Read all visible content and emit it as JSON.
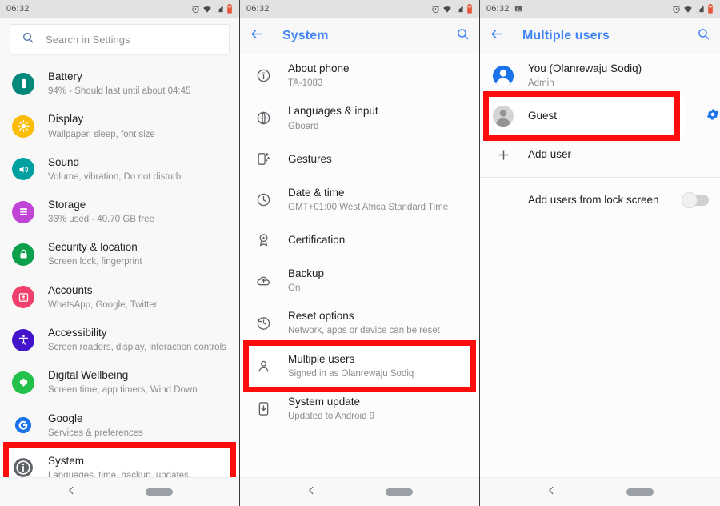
{
  "statusbar": {
    "time": "06:32",
    "icons_right": [
      "alarm-icon",
      "wifi-icon",
      "signal-icon",
      "battery-icon"
    ],
    "panel3_left_icon": "screenshot-icon"
  },
  "panel1": {
    "name": "settings-home",
    "search": {
      "placeholder": "Search in Settings",
      "icon": "search-icon"
    },
    "items": [
      {
        "title": "Battery",
        "subtitle": "94% - Should last until about 04:45",
        "icon": "battery-icon",
        "color": "#00897b"
      },
      {
        "title": "Display",
        "subtitle": "Wallpaper, sleep, font size",
        "icon": "brightness-icon",
        "color": "#fbbc04"
      },
      {
        "title": "Sound",
        "subtitle": "Volume, vibration, Do not disturb",
        "icon": "volume-icon",
        "color": "#00a0a0"
      },
      {
        "title": "Storage",
        "subtitle": "36% used - 40.70 GB free",
        "icon": "storage-icon",
        "color": "#c044d6"
      },
      {
        "title": "Security & location",
        "subtitle": "Screen lock, fingerprint",
        "icon": "lock-icon",
        "color": "#0ca04a"
      },
      {
        "title": "Accounts",
        "subtitle": "WhatsApp, Google, Twitter",
        "icon": "account-card-icon",
        "color": "#f0406b"
      },
      {
        "title": "Accessibility",
        "subtitle": "Screen readers, display, interaction controls",
        "icon": "accessibility-icon",
        "color": "#4414cc"
      },
      {
        "title": "Digital Wellbeing",
        "subtitle": "Screen time, app timers, Wind Down",
        "icon": "wellbeing-icon",
        "color": "#23c04a"
      },
      {
        "title": "Google",
        "subtitle": "Services & preferences",
        "icon": "google-g-icon",
        "color": "#1a73e8"
      },
      {
        "title": "System",
        "subtitle": "Languages, time, backup, updates",
        "icon": "info-circle-icon",
        "color": "#5f6368"
      }
    ],
    "highlight": "System"
  },
  "panel2": {
    "name": "system-settings",
    "appbar": {
      "title": "System",
      "back_icon": "back-arrow-icon",
      "search_icon": "search-icon"
    },
    "items": [
      {
        "title": "About phone",
        "subtitle": "TA-1083",
        "icon": "info-outline-icon"
      },
      {
        "title": "Languages & input",
        "subtitle": "Gboard",
        "icon": "globe-icon"
      },
      {
        "title": "Gestures",
        "subtitle": "",
        "icon": "gesture-phone-icon"
      },
      {
        "title": "Date & time",
        "subtitle": "GMT+01:00 West Africa Standard Time",
        "icon": "clock-icon"
      },
      {
        "title": "Certification",
        "subtitle": "",
        "icon": "certificate-icon"
      },
      {
        "title": "Backup",
        "subtitle": "On",
        "icon": "cloud-upload-icon"
      },
      {
        "title": "Reset options",
        "subtitle": "Network, apps or device can be reset",
        "icon": "restore-icon"
      },
      {
        "title": "Multiple users",
        "subtitle": "Signed in as Olanrewaju Sodiq",
        "icon": "person-icon"
      },
      {
        "title": "System update",
        "subtitle": "Updated to Android 9",
        "icon": "system-update-icon"
      }
    ],
    "highlight": "Multiple users"
  },
  "panel3": {
    "name": "multiple-users",
    "appbar": {
      "title": "Multiple users",
      "back_icon": "back-arrow-icon",
      "search_icon": "search-icon"
    },
    "users": [
      {
        "title": "You (Olanrewaju Sodiq)",
        "subtitle": "Admin",
        "icon": "avatar-blue-icon",
        "has_gear": false
      },
      {
        "title": "Guest",
        "subtitle": "",
        "icon": "avatar-grey-icon",
        "has_gear": true,
        "gear_icon": "gear-icon"
      }
    ],
    "add_user": {
      "label": "Add user",
      "icon": "plus-icon"
    },
    "lock_screen_setting": {
      "label": "Add users from lock screen",
      "toggle_on": false
    },
    "highlight": "Guest"
  },
  "navbar": {
    "back_icon": "back-chevron-icon",
    "home_pill": "home-pill-indicator"
  }
}
